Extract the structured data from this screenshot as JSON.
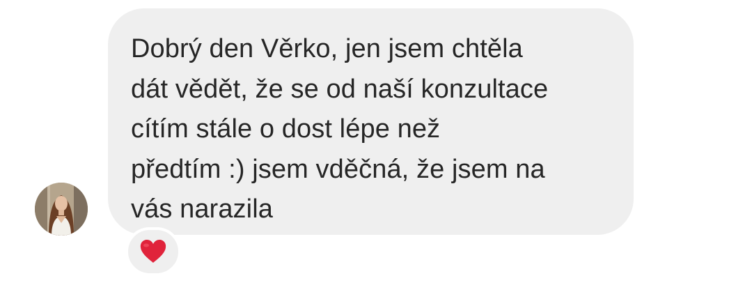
{
  "conversation": {
    "message": {
      "text": "Dobrý den Věrko, jen jsem chtěla\ndát vědět, že se od naší konzultace\ncítím stále o dost lépe než\npředtím :) jsem vděčná, že jsem na\nvás narazila"
    },
    "avatar": {
      "icon": "profile-photo"
    },
    "reaction": {
      "icon": "red-heart-icon",
      "color": "#e0233b"
    },
    "colors": {
      "bubble": "#efefef",
      "text": "#262626",
      "background": "#ffffff"
    }
  }
}
